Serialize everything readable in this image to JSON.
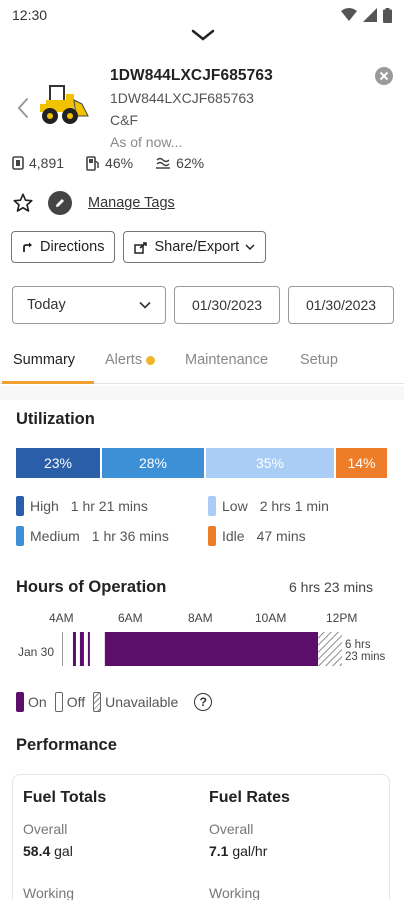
{
  "status_bar": {
    "time": "12:30"
  },
  "asset": {
    "title": "1DW844LXCJF685763",
    "subtitle": "1DW844LXCJF685763",
    "org": "C&F",
    "as_of": "As of now...",
    "stats": {
      "hours": "4,891",
      "fuel": "46%",
      "def": "62%"
    }
  },
  "tags": {
    "manage_label": "Manage Tags"
  },
  "actions": {
    "directions": "Directions",
    "share": "Share/Export"
  },
  "date_filter": {
    "range": "Today",
    "start": "01/30/2023",
    "end": "01/30/2023"
  },
  "tabs": [
    {
      "label": "Summary"
    },
    {
      "label": "Alerts"
    },
    {
      "label": "Maintenance"
    },
    {
      "label": "Setup"
    }
  ],
  "utilization": {
    "title": "Utilization",
    "segments": [
      {
        "label": "23%",
        "value": 23,
        "color": "#2a5ea8"
      },
      {
        "label": "28%",
        "value": 28,
        "color": "#3d8fd6"
      },
      {
        "label": "35%",
        "value": 35,
        "color": "#a9cdf4"
      },
      {
        "label": "14%",
        "value": 14,
        "color": "#ee7d2a"
      }
    ],
    "legend": [
      {
        "name": "High",
        "time": "1 hr 21 mins",
        "color": "#2a5ea8"
      },
      {
        "name": "Low",
        "time": "2 hrs 1 min",
        "color": "#a9cdf4"
      },
      {
        "name": "Medium",
        "time": "1 hr 36 mins",
        "color": "#3d8fd6"
      },
      {
        "name": "Idle",
        "time": "47 mins",
        "color": "#ee7d2a"
      }
    ]
  },
  "hours_of_operation": {
    "title": "Hours of Operation",
    "total": "6 hrs 23 mins",
    "axis": [
      "4AM",
      "6AM",
      "8AM",
      "10AM",
      "12PM"
    ],
    "date": "Jan 30",
    "end_label_1": "6 hrs",
    "end_label_2": "23 mins",
    "legend": {
      "on": "On",
      "off": "Off",
      "unavailable": "Unavailable"
    },
    "on_color": "#5b0f6b"
  },
  "performance": {
    "title": "Performance",
    "fuel_totals": {
      "title": "Fuel Totals",
      "overall_label": "Overall",
      "overall_value": "58.4",
      "overall_unit": "gal",
      "working_label": "Working"
    },
    "fuel_rates": {
      "title": "Fuel Rates",
      "overall_label": "Overall",
      "overall_value": "7.1",
      "overall_unit": "gal/hr",
      "working_label": "Working"
    }
  }
}
